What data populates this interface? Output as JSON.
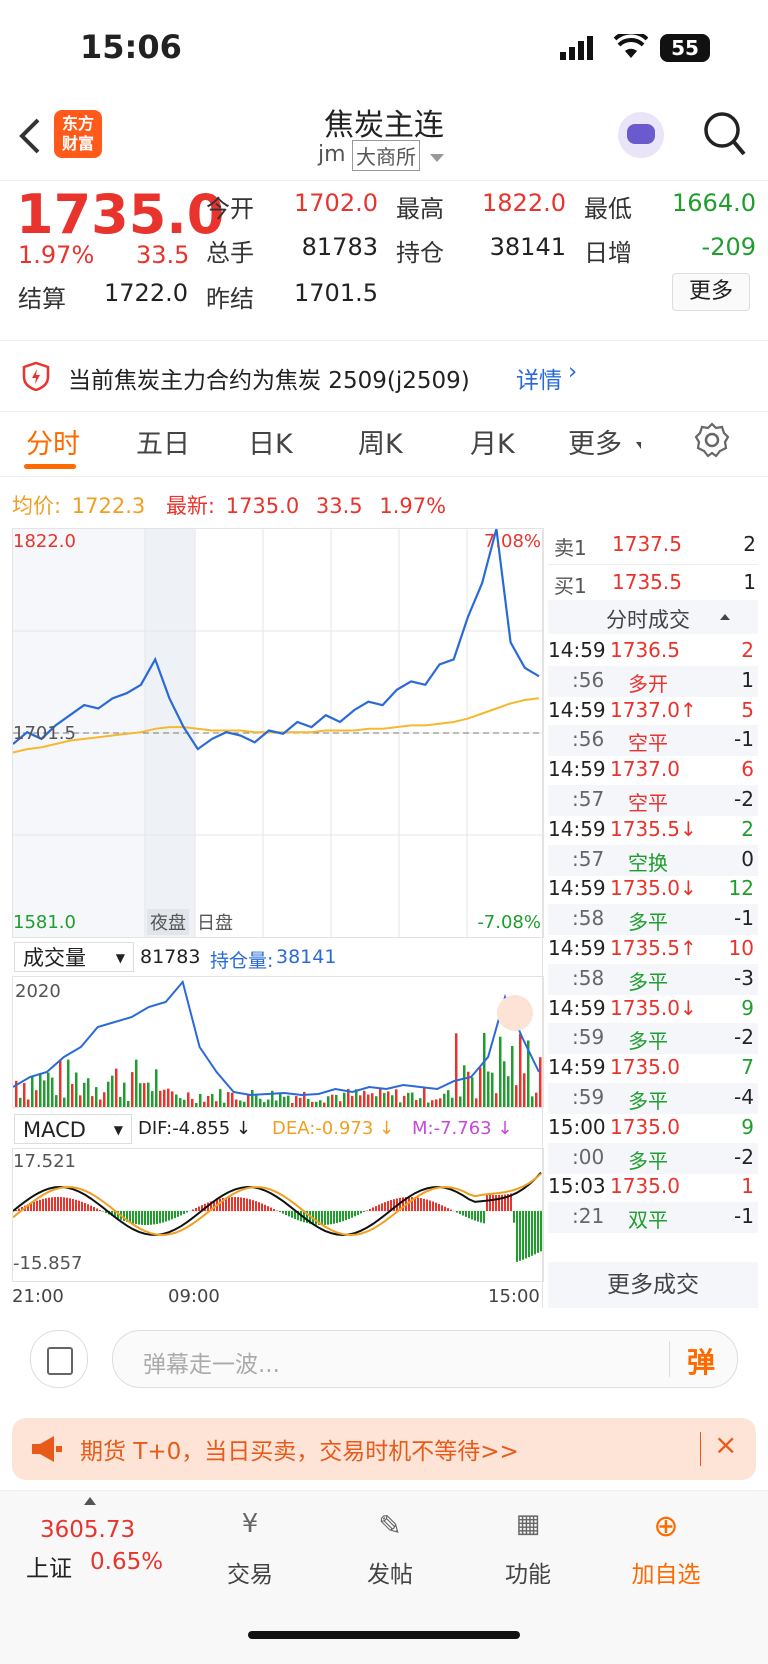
{
  "status_bar": {
    "time": "15:06",
    "battery": "55"
  },
  "nav": {
    "title": "焦炭主连",
    "code": "jm",
    "exchange": "大商所",
    "logo_text": [
      "东方",
      "财富"
    ]
  },
  "quote": {
    "price": "1735.0",
    "change_pct": "1.97%",
    "change": "33.5",
    "open_label": "今开",
    "open": "1702.0",
    "high_label": "最高",
    "high": "1822.0",
    "low_label": "最低",
    "low": "1664.0",
    "volume_label": "总手",
    "volume": "81783",
    "oi_label": "持仓",
    "oi": "38141",
    "oi_change_label": "日增",
    "oi_change": "-209",
    "settle_label": "结算",
    "settle": "1722.0",
    "prev_settle_label": "昨结",
    "prev_settle": "1701.5",
    "more_button": "更多"
  },
  "notice": {
    "text": "当前焦炭主力合约为焦炭 2509(j2509)",
    "link": "详情"
  },
  "tabs": [
    {
      "label": "分时",
      "active": true
    },
    {
      "label": "五日",
      "active": false
    },
    {
      "label": "日K",
      "active": false
    },
    {
      "label": "周K",
      "active": false
    },
    {
      "label": "月K",
      "active": false
    },
    {
      "label": "更多",
      "active": false
    }
  ],
  "legend": {
    "avg_label": "均价:",
    "avg": "1722.3",
    "latest_label": "最新:",
    "latest": "1735.0",
    "change": "33.5",
    "pct": "1.97%"
  },
  "chart_labels": {
    "y_top": "1822.0",
    "y_bottom": "1581.0",
    "y_mid": "1701.5",
    "pct_top": "7.08%",
    "pct_bottom": "-7.08%",
    "night": "夜盘",
    "day": "日盘",
    "vol_selector": "成交量",
    "vol_value": "81783",
    "oi_label": "持仓量:",
    "oi_value": "38141",
    "vol_max": "2020",
    "macd_selector": "MACD",
    "dif": "DIF:-4.855 ↓",
    "dea": "DEA:-0.973 ↓",
    "m": "M:-7.763 ↓",
    "macd_top": "17.521",
    "macd_bottom": "-15.857",
    "x_start": "21:00",
    "x_mid": "09:00",
    "x_end": "15:00"
  },
  "chart_data": {
    "type": "line",
    "ylim": [
      1581.0,
      1822.0
    ],
    "reference": 1701.5,
    "series": [
      {
        "values": [
          1695,
          1702,
          1698,
          1706,
          1712,
          1718,
          1716,
          1722,
          1725,
          1730,
          1745,
          1722,
          1705,
          1692,
          1698,
          1702,
          1700,
          1696,
          1703,
          1701,
          1708,
          1705,
          1712,
          1708,
          1715,
          1720,
          1718,
          1727,
          1732,
          1730,
          1742,
          1745,
          1770,
          1790,
          1822,
          1755,
          1740,
          1735
        ]
      },
      {
        "values": [
          1690,
          1692,
          1693,
          1695,
          1697,
          1698,
          1699,
          1700,
          1701,
          1702,
          1704,
          1705,
          1705,
          1704,
          1703,
          1703,
          1703,
          1702,
          1702,
          1702,
          1702,
          1702,
          1703,
          1703,
          1703,
          1704,
          1704,
          1705,
          1706,
          1706,
          1707,
          1708,
          1710,
          1713,
          1716,
          1719,
          1721,
          1722
        ]
      }
    ]
  },
  "order_book": {
    "ask_label": "卖1",
    "ask_price": "1737.5",
    "ask_qty": "2",
    "bid_label": "买1",
    "bid_price": "1735.5",
    "bid_qty": "1",
    "trades_title": "分时成交",
    "trades": [
      {
        "t": "14:59",
        "p": "1736.5",
        "q": "2",
        "pc": "red",
        "qc": "red"
      },
      {
        "t": ":56",
        "p": "多开",
        "q": "1",
        "pc": "red",
        "qc": "dark"
      },
      {
        "t": "14:59",
        "p": "1737.0↑",
        "q": "5",
        "pc": "red",
        "qc": "red"
      },
      {
        "t": ":56",
        "p": "空平",
        "q": "-1",
        "pc": "red",
        "qc": "dark"
      },
      {
        "t": "14:59",
        "p": "1737.0",
        "q": "6",
        "pc": "red",
        "qc": "red"
      },
      {
        "t": ":57",
        "p": "空平",
        "q": "-2",
        "pc": "red",
        "qc": "dark"
      },
      {
        "t": "14:59",
        "p": "1735.5↓",
        "q": "2",
        "pc": "red",
        "qc": "green"
      },
      {
        "t": ":57",
        "p": "空换",
        "q": "0",
        "pc": "green",
        "qc": "dark"
      },
      {
        "t": "14:59",
        "p": "1735.0↓",
        "q": "12",
        "pc": "red",
        "qc": "green"
      },
      {
        "t": ":58",
        "p": "多平",
        "q": "-1",
        "pc": "green",
        "qc": "dark"
      },
      {
        "t": "14:59",
        "p": "1735.5↑",
        "q": "10",
        "pc": "red",
        "qc": "red"
      },
      {
        "t": ":58",
        "p": "多平",
        "q": "-3",
        "pc": "green",
        "qc": "dark"
      },
      {
        "t": "14:59",
        "p": "1735.0↓",
        "q": "9",
        "pc": "red",
        "qc": "green"
      },
      {
        "t": ":59",
        "p": "多平",
        "q": "-2",
        "pc": "green",
        "qc": "dark"
      },
      {
        "t": "14:59",
        "p": "1735.0",
        "q": "7",
        "pc": "red",
        "qc": "green"
      },
      {
        "t": ":59",
        "p": "多平",
        "q": "-4",
        "pc": "green",
        "qc": "dark"
      },
      {
        "t": "15:00",
        "p": "1735.0",
        "q": "9",
        "pc": "red",
        "qc": "green"
      },
      {
        "t": ":00",
        "p": "多平",
        "q": "-2",
        "pc": "green",
        "qc": "dark"
      },
      {
        "t": "15:03",
        "p": "1735.0",
        "q": "1",
        "pc": "red",
        "qc": "red"
      },
      {
        "t": ":21",
        "p": "双平",
        "q": "-1",
        "pc": "green",
        "qc": "dark"
      }
    ],
    "more_trades": "更多成交"
  },
  "comment": {
    "placeholder": "弹幕走一波...",
    "danmu": "弹"
  },
  "promo": {
    "text": "期货 T+0，当日买卖，交易时机不等待>>"
  },
  "bottom_nav": {
    "index_value": "3605.73",
    "index_name": "上证",
    "index_pct": "0.65%",
    "trade": "交易",
    "post": "发帖",
    "func": "功能",
    "add": "加自选"
  },
  "colors": {
    "up": "#e8342d",
    "down": "#1f9e2e",
    "accent": "#ff6a00",
    "price_line": "#2a6ad8",
    "avg_line": "#f5b82e"
  }
}
